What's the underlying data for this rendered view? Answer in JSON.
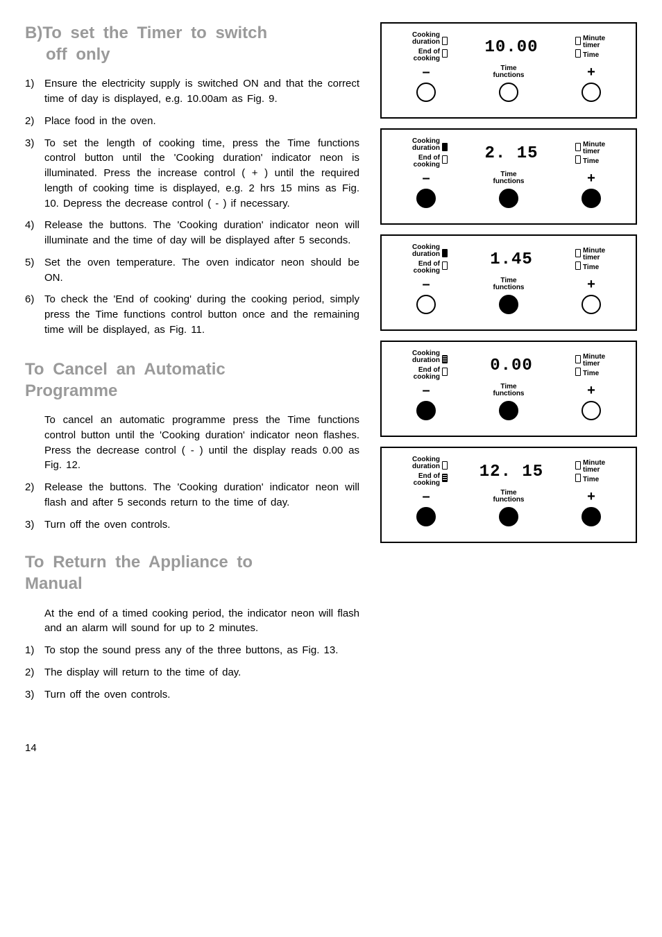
{
  "sectionB": {
    "heading_prefix": "B)",
    "heading_line1": "To set the Timer to switch",
    "heading_line2": "off only",
    "items": [
      {
        "num": "1)",
        "text": "Ensure the electricity supply is switched ON and that the correct time of day is displayed, e.g. 10.00am as Fig. 9."
      },
      {
        "num": "2)",
        "text": "Place food in the oven."
      },
      {
        "num": "3)",
        "text": "To set the length of cooking time, press the Time functions control  button  until the 'Cooking duration' indicator neon is illuminated.  Press the increase control ( + ) until the required length of cooking time is displayed, e.g. 2 hrs 15 mins as Fig. 10.  Depress the decrease control ( - ) if necessary."
      },
      {
        "num": "4)",
        "text": "Release the buttons.  The 'Cooking duration' indicator neon will illuminate and the time of day will be displayed  after 5 seconds."
      },
      {
        "num": "5)",
        "text": "Set  the  oven  temperature.  The  oven indicator neon should be ON."
      },
      {
        "num": "6)",
        "text": "To check the 'End of cooking' during the cooking period, simply press the Time functions control button once and the remaining time will be displayed, as Fig. 11."
      }
    ]
  },
  "sectionCancel": {
    "heading_line1": "To Cancel an Automatic",
    "heading_line2": "Programme",
    "intro": "To cancel an automatic programme press the Time functions control button until the 'Cooking duration' indicator neon flashes.  Press the decrease control ( - ) until the display reads 0.00 as Fig. 12.",
    "items": [
      {
        "num": "2)",
        "text": "Release the  buttons.  The 'Cooking duration' indicator neon will flash and after 5 seconds return to the time of day."
      },
      {
        "num": "3)",
        "text": "Turn off the oven controls."
      }
    ]
  },
  "sectionReturn": {
    "heading_line1": "To Return the Appliance to",
    "heading_line2": "Manual",
    "intro": "At the end of a timed cooking period, the indicator neon will flash and an alarm will sound for up to 2 minutes.",
    "items": [
      {
        "num": "1)",
        "text": "To stop the sound press any of the three buttons, as Fig. 13."
      },
      {
        "num": "2)",
        "text": "The display will return to the time of day."
      },
      {
        "num": "3)",
        "text": "Turn off the oven controls."
      }
    ]
  },
  "labels": {
    "cooking_duration_l1": "Cooking",
    "cooking_duration_l2": "duration",
    "end_of_l1": "End of",
    "end_of_l2": "cooking",
    "minute_l1": "Minute",
    "minute_l2": "timer",
    "time_label": "Time",
    "time_functions_l1": "Time",
    "time_functions_l2": "functions"
  },
  "figs": [
    {
      "display": "10.00",
      "ind_tl": "empty",
      "ind_bl": "empty",
      "ind_tr": "empty",
      "ind_br": "empty",
      "minus_pressed": false,
      "mid_pressed": false,
      "plus_pressed": false
    },
    {
      "display": "2. 15",
      "ind_tl": "filled",
      "ind_bl": "empty",
      "ind_tr": "empty",
      "ind_br": "empty",
      "minus_pressed": true,
      "mid_pressed": true,
      "plus_pressed": true
    },
    {
      "display": "1.45",
      "ind_tl": "filled",
      "ind_bl": "empty",
      "ind_tr": "empty",
      "ind_br": "empty",
      "minus_pressed": false,
      "mid_pressed": true,
      "plus_pressed": false
    },
    {
      "display": "0.00",
      "ind_tl": "dotted",
      "ind_bl": "empty",
      "ind_tr": "empty",
      "ind_br": "empty",
      "minus_pressed": true,
      "mid_pressed": true,
      "plus_pressed": false
    },
    {
      "display": "12. 15",
      "ind_tl": "empty",
      "ind_bl": "dotted",
      "ind_tr": "empty",
      "ind_br": "empty",
      "minus_pressed": true,
      "mid_pressed": true,
      "plus_pressed": true
    }
  ],
  "signs": {
    "minus": "–",
    "plus": "+"
  },
  "page_number": "14"
}
